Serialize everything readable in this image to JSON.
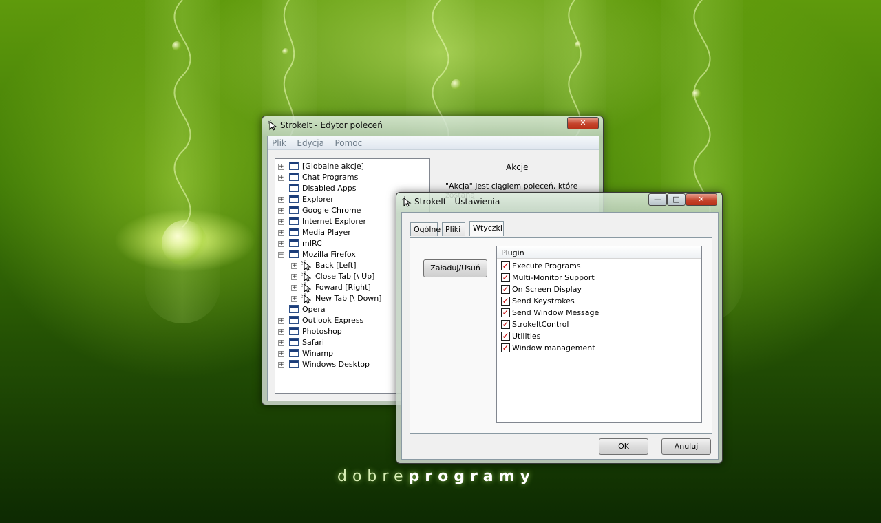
{
  "background": {
    "brand_light": "dobre",
    "brand_bold": "programy"
  },
  "editor_window": {
    "title": "StrokeIt - Edytor poleceń",
    "close_glyph": "✕",
    "menu": [
      "Plik",
      "Edycja",
      "Pomoc"
    ],
    "tree": [
      {
        "label": "[Globalne akcje]",
        "level": 0,
        "expander": "+",
        "icon": "window-icon"
      },
      {
        "label": "Chat Programs",
        "level": 0,
        "expander": "+",
        "icon": "window-icon"
      },
      {
        "label": "Disabled Apps",
        "level": 0,
        "expander": "",
        "icon": "window-icon"
      },
      {
        "label": "Explorer",
        "level": 0,
        "expander": "+",
        "icon": "window-icon"
      },
      {
        "label": "Google Chrome",
        "level": 0,
        "expander": "+",
        "icon": "window-icon"
      },
      {
        "label": "Internet Explorer",
        "level": 0,
        "expander": "+",
        "icon": "window-icon"
      },
      {
        "label": "Media Player",
        "level": 0,
        "expander": "+",
        "icon": "window-icon"
      },
      {
        "label": "mIRC",
        "level": 0,
        "expander": "+",
        "icon": "window-icon"
      },
      {
        "label": "Mozilla Firefox",
        "level": 0,
        "expander": "−",
        "icon": "window-icon"
      },
      {
        "label": "Back [Left]",
        "level": 1,
        "expander": "+",
        "icon": "gesture-cursor-icon"
      },
      {
        "label": "Close Tab [\\ Up]",
        "level": 1,
        "expander": "+",
        "icon": "gesture-cursor-icon"
      },
      {
        "label": "Foward [Right]",
        "level": 1,
        "expander": "+",
        "icon": "gesture-cursor-icon"
      },
      {
        "label": "New Tab [\\ Down]",
        "level": 1,
        "expander": "+",
        "icon": "gesture-cursor-icon"
      },
      {
        "label": "Opera",
        "level": 0,
        "expander": "",
        "icon": "window-icon"
      },
      {
        "label": "Outlook Express",
        "level": 0,
        "expander": "+",
        "icon": "window-icon"
      },
      {
        "label": "Photoshop",
        "level": 0,
        "expander": "+",
        "icon": "window-icon"
      },
      {
        "label": "Safari",
        "level": 0,
        "expander": "+",
        "icon": "window-icon"
      },
      {
        "label": "Winamp",
        "level": 0,
        "expander": "+",
        "icon": "window-icon"
      },
      {
        "label": "Windows Desktop",
        "level": 0,
        "expander": "+",
        "icon": "window-icon"
      }
    ],
    "panel_title": "Akcje",
    "panel_text": "\"Akcja\" jest ciągiem poleceń, które zostaną"
  },
  "settings_window": {
    "title": "StrokeIt - Ustawienia",
    "min_glyph": "—",
    "max_glyph": "□",
    "close_glyph": "✕",
    "tabs": [
      "Ogólne",
      "Pliki",
      "Wtyczki"
    ],
    "active_tab": "Wtyczki",
    "load_button": "Załaduj/Usuń",
    "list_header": "Plugin",
    "plugins": [
      {
        "label": "Execute Programs",
        "checked": true
      },
      {
        "label": "Multi-Monitor Support",
        "checked": true
      },
      {
        "label": "On Screen Display",
        "checked": true
      },
      {
        "label": "Send Keystrokes",
        "checked": true
      },
      {
        "label": "Send Window Message",
        "checked": true
      },
      {
        "label": "StrokeItControl",
        "checked": true
      },
      {
        "label": "Utilities",
        "checked": true
      },
      {
        "label": "Window management",
        "checked": true
      }
    ],
    "ok_button": "OK",
    "cancel_button": "Anuluj"
  },
  "colors": {
    "accent_green": "#5f9a0c",
    "check_red": "#c40000",
    "close_red": "#c5432b"
  }
}
